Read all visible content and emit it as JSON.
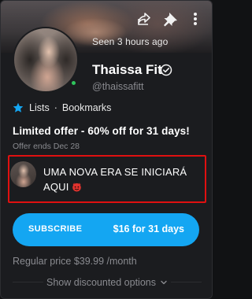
{
  "header": {
    "seen_status": "Seen 3 hours ago",
    "share_icon": "share-icon",
    "pin_icon": "pin-icon",
    "more_icon": "more-vertical-icon"
  },
  "profile": {
    "name": "Thaissa Fit",
    "handle": "@thaissafitt",
    "verified_icon": "verified-badge-icon",
    "online": true
  },
  "links": {
    "star_icon": "star-icon",
    "lists_label": "Lists",
    "separator": "·",
    "bookmarks_label": "Bookmarks"
  },
  "offer": {
    "title": "Limited offer - 60% off for 31 days!",
    "ends": "Offer ends Dec 28"
  },
  "message": {
    "text": "UMA NOVA ERA SE INICIARÁ AQUI",
    "emoji_icon": "devil-emoji-icon"
  },
  "subscribe": {
    "label": "SUBSCRIBE",
    "price": "$16 for 31 days"
  },
  "regular_price": "Regular price $39.99 /month",
  "discounted": {
    "label": "Show discounted options",
    "icon": "chevron-down-icon"
  },
  "colors": {
    "accent": "#14a6f2",
    "highlight_border": "#e01010",
    "background": "#1b1c1f",
    "muted_text": "#8a8b90"
  }
}
